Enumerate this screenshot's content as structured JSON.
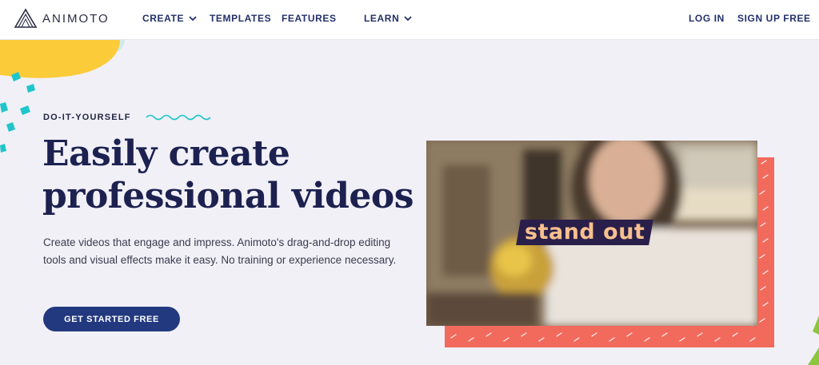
{
  "header": {
    "logo_text": "ANIMOTO",
    "nav": {
      "create": "CREATE",
      "templates": "TEMPLATES",
      "features": "FEATURES",
      "learn": "LEARN",
      "login": "LOG IN",
      "signup": "SIGN UP FREE"
    }
  },
  "hero": {
    "eyebrow": "DO-IT-YOURSELF",
    "headline_line1": "Easily create",
    "headline_line2": "professional videos",
    "subtext": "Create videos that engage and impress. Animoto's drag-and-drop editing tools and visual effects make it easy. No training or experience necessary.",
    "cta": "GET STARTED FREE"
  },
  "video": {
    "caption": "stand out"
  },
  "colors": {
    "nav": "#23306b",
    "headline": "#1c2150",
    "cta_bg": "#23397f",
    "coral": "#f26a5c",
    "yellow": "#fbcb3a",
    "teal": "#1fc6c9",
    "caption_bg": "#2a1f4a",
    "caption_text": "#f7c08e"
  },
  "icons": [
    "animoto-logo-icon",
    "chevron-down-icon",
    "squiggle-decoration"
  ]
}
